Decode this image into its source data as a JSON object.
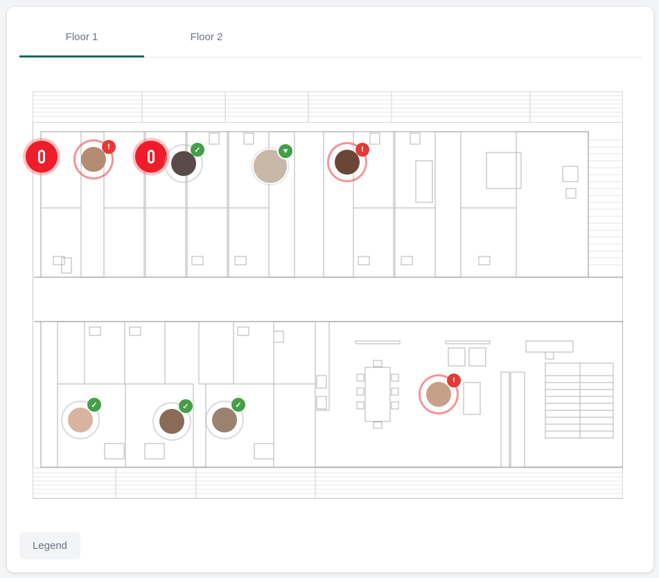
{
  "tabs": [
    {
      "label": "Floor 1",
      "active": true
    },
    {
      "label": "Floor 2",
      "active": false
    }
  ],
  "floor_plan": {
    "residents": [
      {
        "id": "alarm-1",
        "status": "alarm"
      },
      {
        "id": "resident-1",
        "status": "alert",
        "badge": "red"
      },
      {
        "id": "alarm-2",
        "status": "alarm"
      },
      {
        "id": "resident-2",
        "status": "ok",
        "badge": "green"
      },
      {
        "id": "resident-3",
        "status": "ok",
        "badge": "heart"
      },
      {
        "id": "resident-4",
        "status": "alert",
        "badge": "red"
      },
      {
        "id": "resident-5",
        "status": "alert",
        "badge": "red"
      },
      {
        "id": "resident-6",
        "status": "ok",
        "badge": "green"
      },
      {
        "id": "resident-7",
        "status": "ok",
        "badge": "green"
      },
      {
        "id": "resident-8",
        "status": "ok",
        "badge": "green"
      }
    ],
    "colors": {
      "alarm": "#ef1d2a",
      "ok": "#43a047",
      "accent": "#0e6b5e"
    }
  },
  "legend": {
    "label": "Legend"
  }
}
